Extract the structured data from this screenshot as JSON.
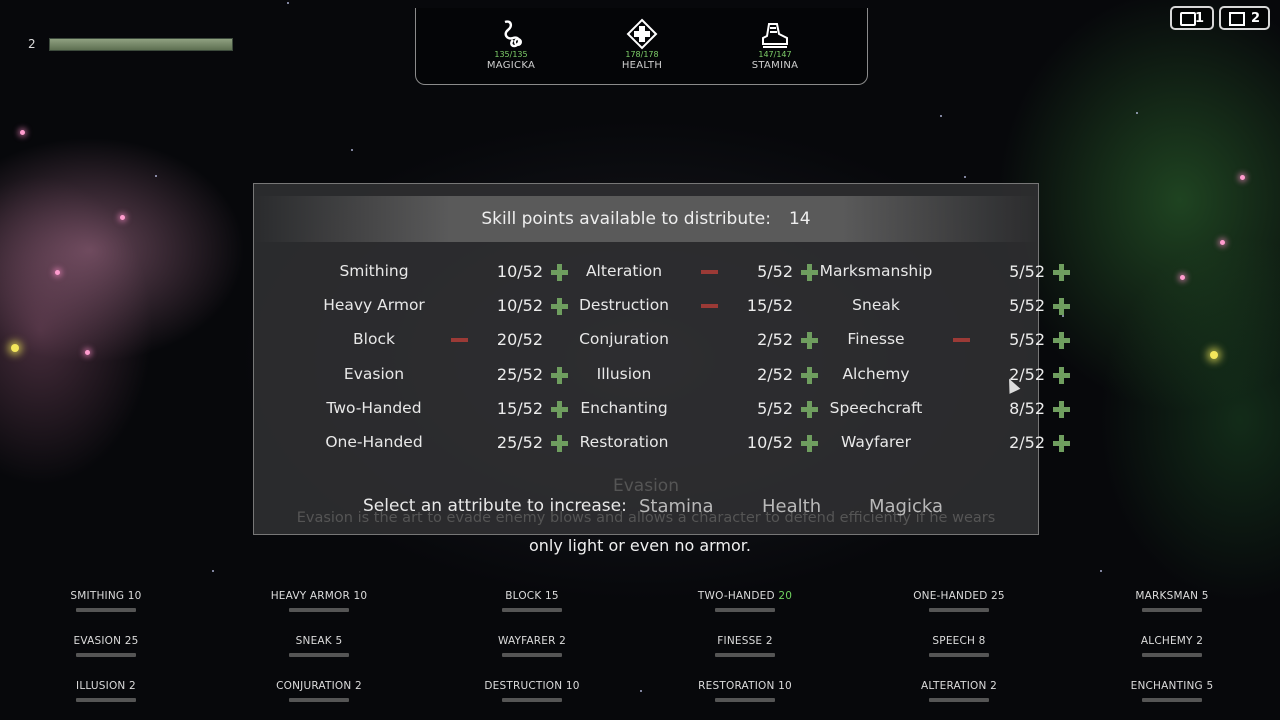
{
  "player": {
    "level": "2",
    "xp_fraction": 1.0
  },
  "attributes": [
    {
      "name": "MAGICKA",
      "value": "135/135",
      "icon": "magicka-icon"
    },
    {
      "name": "HEALTH",
      "value": "178/178",
      "icon": "health-icon"
    },
    {
      "name": "STAMINA",
      "value": "147/147",
      "icon": "stamina-icon"
    }
  ],
  "counters": [
    {
      "icon": "chat-icon",
      "value": "1"
    },
    {
      "icon": "box-icon",
      "value": "2"
    }
  ],
  "dialog": {
    "header_label": "Skill points available to distribute:",
    "points": "14",
    "columns": [
      [
        {
          "name": "Smithing",
          "value": "10/52",
          "minus": false,
          "plus": true
        },
        {
          "name": "Heavy Armor",
          "value": "10/52",
          "minus": false,
          "plus": true
        },
        {
          "name": "Block",
          "value": "20/52",
          "minus": true,
          "plus": false
        },
        {
          "name": "Evasion",
          "value": "25/52",
          "minus": false,
          "plus": true
        },
        {
          "name": "Two-Handed",
          "value": "15/52",
          "minus": false,
          "plus": true
        },
        {
          "name": "One-Handed",
          "value": "25/52",
          "minus": false,
          "plus": true
        }
      ],
      [
        {
          "name": "Alteration",
          "value": "5/52",
          "minus": true,
          "plus": true
        },
        {
          "name": "Destruction",
          "value": "15/52",
          "minus": true,
          "plus": false
        },
        {
          "name": "Conjuration",
          "value": "2/52",
          "minus": false,
          "plus": true
        },
        {
          "name": "Illusion",
          "value": "2/52",
          "minus": false,
          "plus": true
        },
        {
          "name": "Enchanting",
          "value": "5/52",
          "minus": false,
          "plus": true
        },
        {
          "name": "Restoration",
          "value": "10/52",
          "minus": false,
          "plus": true
        }
      ],
      [
        {
          "name": "Marksmanship",
          "value": "5/52",
          "minus": false,
          "plus": true
        },
        {
          "name": "Sneak",
          "value": "5/52",
          "minus": false,
          "plus": true
        },
        {
          "name": "Finesse",
          "value": "5/52",
          "minus": true,
          "plus": true
        },
        {
          "name": "Alchemy",
          "value": "2/52",
          "minus": false,
          "plus": true
        },
        {
          "name": "Speechcraft",
          "value": "8/52",
          "minus": false,
          "plus": true
        },
        {
          "name": "Wayfarer",
          "value": "2/52",
          "minus": false,
          "plus": true
        }
      ]
    ],
    "select_label": "Select an attribute to increase:",
    "options": [
      "Stamina",
      "Health",
      "Magicka"
    ],
    "description_title": "Evasion",
    "description_line1": "Evasion is the art to evade enemy blows and allows a character to defend efficiently if he wears",
    "description_line2": "only light or even no armor."
  },
  "bottom_skills": [
    [
      {
        "label": "SMITHING",
        "value": "10"
      },
      {
        "label": "HEAVY ARMOR",
        "value": "10"
      },
      {
        "label": "BLOCK",
        "value": "15"
      },
      {
        "label": "TWO-HANDED",
        "value": "20",
        "highlight": true
      },
      {
        "label": "ONE-HANDED",
        "value": "25"
      },
      {
        "label": "MARKSMAN",
        "value": "5"
      }
    ],
    [
      {
        "label": "EVASION",
        "value": "25"
      },
      {
        "label": "SNEAK",
        "value": "5"
      },
      {
        "label": "WAYFARER",
        "value": "2"
      },
      {
        "label": "FINESSE",
        "value": "2"
      },
      {
        "label": "SPEECH",
        "value": "8"
      },
      {
        "label": "ALCHEMY",
        "value": "2"
      }
    ],
    [
      {
        "label": "ILLUSION",
        "value": "2"
      },
      {
        "label": "CONJURATION",
        "value": "2"
      },
      {
        "label": "DESTRUCTION",
        "value": "10"
      },
      {
        "label": "RESTORATION",
        "value": "10"
      },
      {
        "label": "ALTERATION",
        "value": "2"
      },
      {
        "label": "ENCHANTING",
        "value": "5"
      }
    ]
  ],
  "colors": {
    "plus": "#6f9e5f",
    "minus": "#9b3a36",
    "attr_value": "#7fcf6a",
    "highlight": "#6fd15f"
  }
}
